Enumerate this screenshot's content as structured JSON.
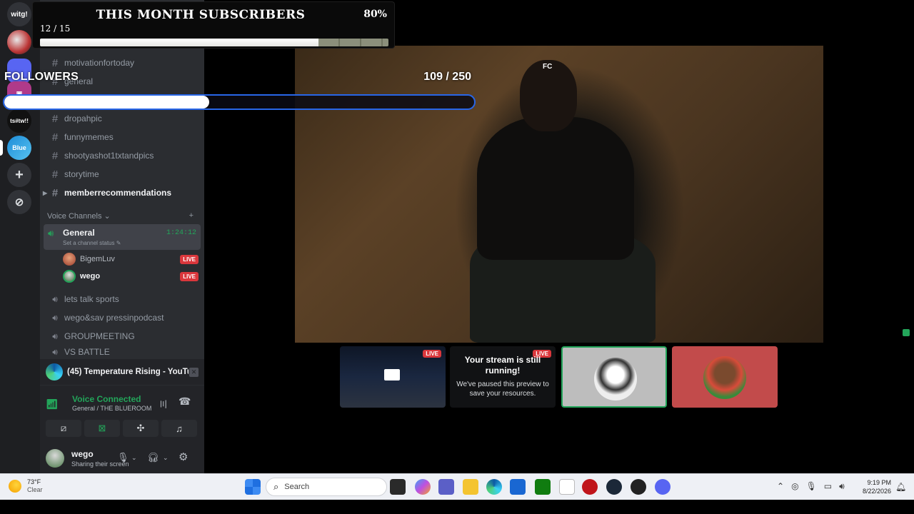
{
  "rail": {
    "server_top_label": "witg!",
    "server_5_label": "ts#tw!!",
    "server_6_label": "Blue"
  },
  "sidebar": {
    "channels": [
      {
        "name": "motivationfortoday"
      },
      {
        "name": "general"
      },
      {
        "name": "dropahpic"
      },
      {
        "name": "funnymemes"
      },
      {
        "name": "shootyashot1txtandpics"
      },
      {
        "name": "storytime"
      },
      {
        "name": "memberrecommendations"
      }
    ],
    "voice_header": "Voice Channels",
    "voice_general": {
      "name": "General",
      "timer": "1:24:12",
      "status": "Set a channel status"
    },
    "members": [
      {
        "name": "BigemLuv",
        "badge": "LIVE"
      },
      {
        "name": "wego",
        "badge": "LIVE"
      }
    ],
    "voice_channels": [
      {
        "name": "lets talk sports"
      },
      {
        "name": "wego&sav pressinpodcast"
      },
      {
        "name": "GROUPMEETING"
      },
      {
        "name": "VS BATTLE"
      }
    ]
  },
  "media_bar": {
    "title": "(45) Temperature Rising - YouTube ..."
  },
  "voice_connection": {
    "label": "Voice Connected",
    "sub": "General / THE BLUEROOM"
  },
  "user": {
    "name": "wego",
    "status": "Sharing their screen"
  },
  "stream": {
    "watermark": "FC",
    "preview_live": "LIVE",
    "paused_live": "LIVE",
    "paused_title": "Your stream is still running!",
    "paused_text": "We've paused this preview to save your resources."
  },
  "subscribers_widget": {
    "title": "THIS MONTH SUBSCRIBERS",
    "percent": "80%",
    "count": "12 / 15",
    "progress": 0.8
  },
  "followers_widget": {
    "label": "FOLLOWERS",
    "count": "109 / 250",
    "progress": 0.436
  },
  "taskbar": {
    "temp": "73°F",
    "condition": "Clear",
    "search_placeholder": "Search",
    "time": "9:19 PM",
    "date": "8/22/2026"
  }
}
